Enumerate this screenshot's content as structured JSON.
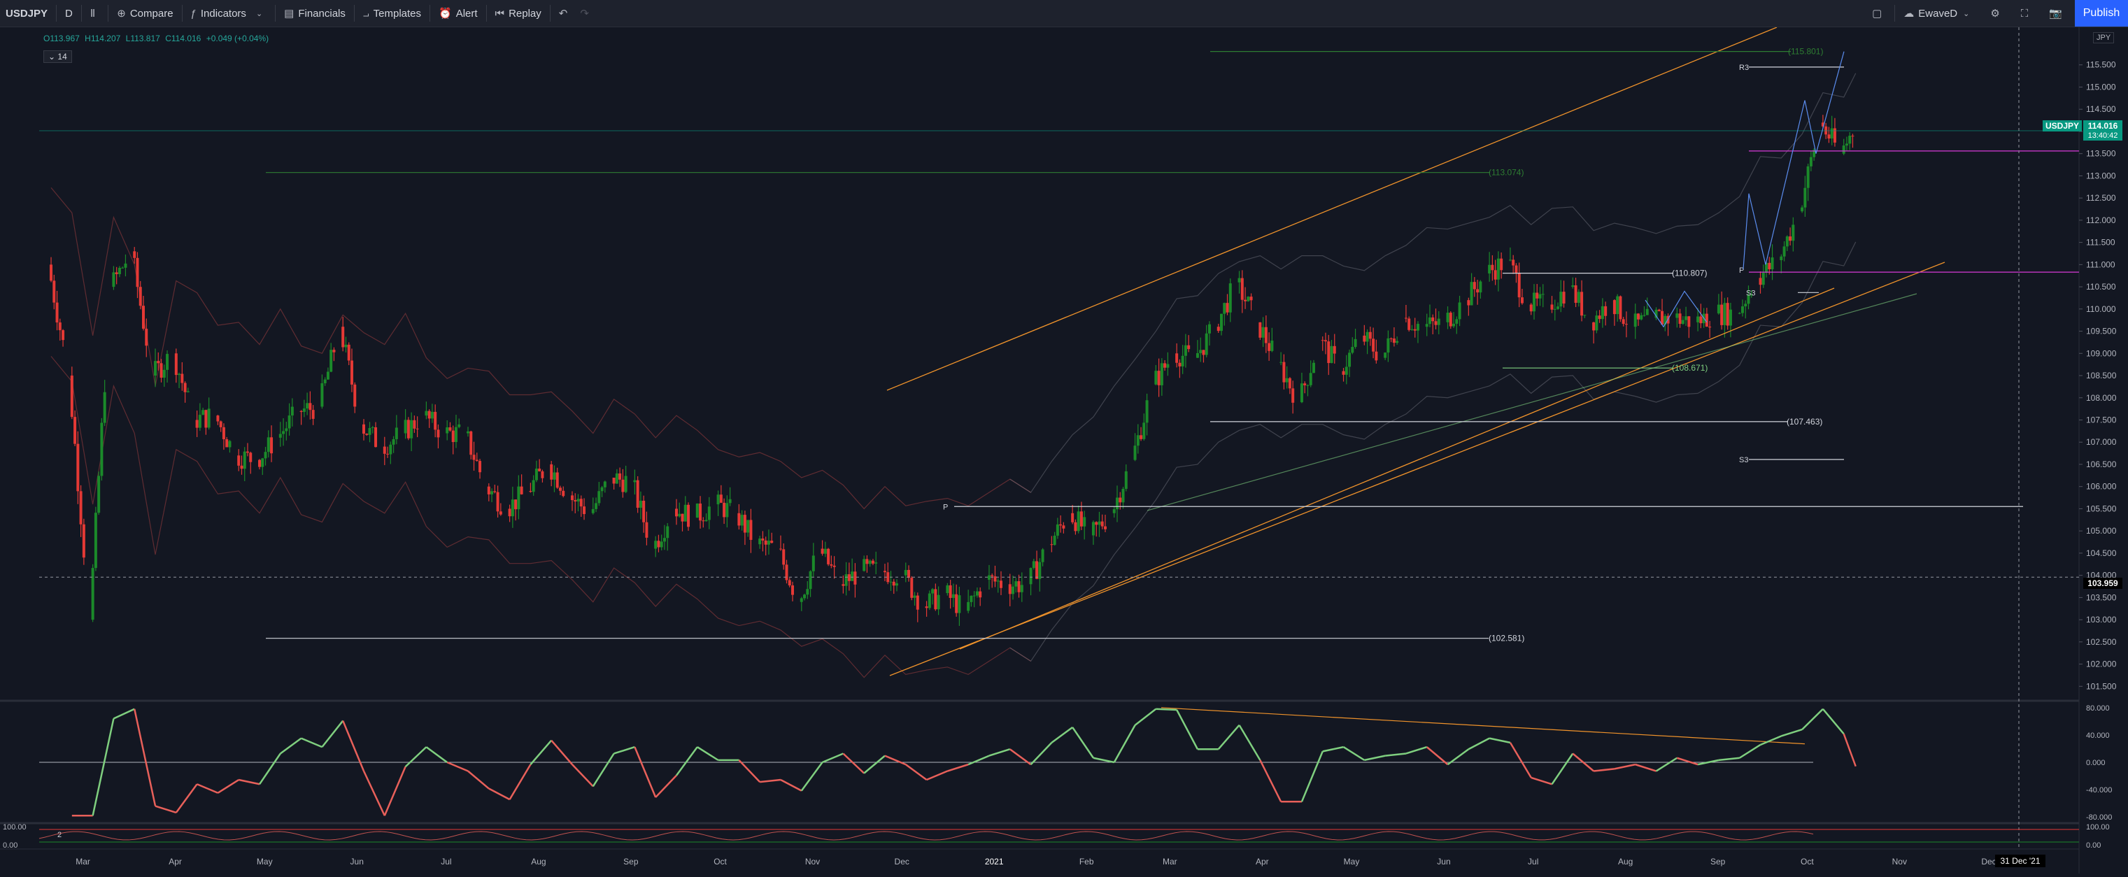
{
  "toolbar": {
    "symbol": "USDJPY",
    "interval": "D",
    "compare": "Compare",
    "indicators": "Indicators",
    "financials": "Financials",
    "templates": "Templates",
    "alert": "Alert",
    "replay": "Replay",
    "user": "EwaveD",
    "publish": "Publish",
    "icons": [
      "bar-style-icon",
      "plus-circle-icon",
      "fx-icon",
      "chevron-down-icon",
      "financials-icon",
      "templates-icon",
      "alarm-icon",
      "replay-icon",
      "undo-icon",
      "redo-icon",
      "square-icon",
      "cloud-icon",
      "settings-gear-icon",
      "fullscreen-icon",
      "camera-icon"
    ]
  },
  "legend": {
    "open": "O113.967",
    "high": "H114.207",
    "low": "L113.817",
    "close": "C114.016",
    "change": "+0.049 (+0.04%)",
    "ma_length": "14"
  },
  "price_scale": {
    "currency": "JPY",
    "current_symbol": "USDJPY",
    "current_price": "114.016",
    "countdown": "13:40:42",
    "crosshair_price": "103.959",
    "labels": [
      "115.500",
      "115.000",
      "114.500",
      "114.000",
      "113.500",
      "113.000",
      "112.500",
      "112.000",
      "111.500",
      "111.000",
      "110.500",
      "110.000",
      "109.500",
      "109.000",
      "108.500",
      "108.000",
      "107.500",
      "107.000",
      "106.500",
      "106.000",
      "105.500",
      "105.000",
      "104.500",
      "104.000",
      "103.500",
      "103.000",
      "102.500",
      "102.000",
      "101.500"
    ]
  },
  "time_axis": {
    "labels": [
      "Mar",
      "Apr",
      "May",
      "Jun",
      "Jul",
      "Aug",
      "Sep",
      "Oct",
      "Nov",
      "Dec",
      "2021",
      "Feb",
      "Mar",
      "Apr",
      "May",
      "Jun",
      "Jul",
      "Aug",
      "Sep",
      "Oct",
      "Nov",
      "Dec"
    ],
    "crosshair_date": "31 Dec '21"
  },
  "annotations": {
    "level_115801": "(115.801)",
    "level_113074": "(113.074)",
    "level_110807": "(110.807)",
    "level_108671": "(108.671)",
    "level_107463": "(107.463)",
    "level_102581": "(102.581)",
    "r3": "R3",
    "s3a": "S3",
    "s3b": "S3",
    "p1": "P",
    "p2": "P"
  },
  "osc_scale": [
    "80.000",
    "40.000",
    "0.000",
    "-40.000",
    "-80.000"
  ],
  "osc2": {
    "label": "2",
    "scale_top": "100.00",
    "scale_bottom": "0.00",
    "right_top": "100.00",
    "right_bottom": "0.00"
  },
  "colors": {
    "up": "#089981",
    "up_candle": "#1b8a2a",
    "down": "#e53935",
    "channel": "#f0932b",
    "magenta": "#d83ad8",
    "green_line": "#2e7d32",
    "osc_up": "#7fcf7f",
    "osc_down": "#e8605a"
  },
  "chart_data": {
    "type": "candlestick",
    "symbol": "USDJPY",
    "interval": "D",
    "ylim": [
      101.3,
      116.0
    ],
    "x_range": [
      "2020-02-20",
      "2022-01-05"
    ],
    "series": [
      {
        "name": "USDJPY",
        "points": [
          [
            "2020-02-24",
            111.0
          ],
          [
            "2020-03-02",
            108.5
          ],
          [
            "2020-03-09",
            103.0
          ],
          [
            "2020-03-16",
            110.5
          ],
          [
            "2020-03-23",
            111.3
          ],
          [
            "2020-03-30",
            108.5
          ],
          [
            "2020-04-06",
            109.0
          ],
          [
            "2020-04-13",
            107.5
          ],
          [
            "2020-04-20",
            107.6
          ],
          [
            "2020-04-27",
            106.7
          ],
          [
            "2020-05-04",
            106.6
          ],
          [
            "2020-05-11",
            107.1
          ],
          [
            "2020-05-18",
            107.7
          ],
          [
            "2020-05-25",
            107.8
          ],
          [
            "2020-06-01",
            109.6
          ],
          [
            "2020-06-08",
            107.4
          ],
          [
            "2020-06-15",
            106.9
          ],
          [
            "2020-06-22",
            107.2
          ],
          [
            "2020-06-29",
            107.6
          ],
          [
            "2020-07-06",
            107.2
          ],
          [
            "2020-07-13",
            107.2
          ],
          [
            "2020-07-20",
            106.0
          ],
          [
            "2020-07-27",
            105.5
          ],
          [
            "2020-08-03",
            105.9
          ],
          [
            "2020-08-10",
            106.5
          ],
          [
            "2020-08-17",
            105.8
          ],
          [
            "2020-08-24",
            105.4
          ],
          [
            "2020-08-31",
            106.2
          ],
          [
            "2020-09-07",
            106.1
          ],
          [
            "2020-09-14",
            104.6
          ],
          [
            "2020-09-21",
            105.5
          ],
          [
            "2020-09-28",
            105.3
          ],
          [
            "2020-10-05",
            105.6
          ],
          [
            "2020-10-12",
            105.4
          ],
          [
            "2020-10-19",
            104.7
          ],
          [
            "2020-10-26",
            104.6
          ],
          [
            "2020-11-02",
            103.4
          ],
          [
            "2020-11-09",
            104.6
          ],
          [
            "2020-11-16",
            103.8
          ],
          [
            "2020-11-23",
            104.1
          ],
          [
            "2020-11-30",
            104.1
          ],
          [
            "2020-12-07",
            104.0
          ],
          [
            "2020-12-14",
            103.3
          ],
          [
            "2020-12-21",
            103.6
          ],
          [
            "2020-12-28",
            103.2
          ],
          [
            "2021-01-04",
            103.9
          ],
          [
            "2021-01-11",
            103.8
          ],
          [
            "2021-01-18",
            103.8
          ],
          [
            "2021-01-25",
            104.7
          ],
          [
            "2021-02-01",
            105.4
          ],
          [
            "2021-02-08",
            104.9
          ],
          [
            "2021-02-15",
            105.4
          ],
          [
            "2021-02-22",
            106.6
          ],
          [
            "2021-03-01",
            108.3
          ],
          [
            "2021-03-08",
            109.0
          ],
          [
            "2021-03-15",
            108.9
          ],
          [
            "2021-03-22",
            109.6
          ],
          [
            "2021-03-29",
            110.6
          ],
          [
            "2021-04-05",
            109.7
          ],
          [
            "2021-04-12",
            108.8
          ],
          [
            "2021-04-19",
            107.9
          ],
          [
            "2021-04-26",
            109.3
          ],
          [
            "2021-05-03",
            108.6
          ],
          [
            "2021-05-10",
            109.4
          ],
          [
            "2021-05-17",
            108.9
          ],
          [
            "2021-05-24",
            109.8
          ],
          [
            "2021-05-31",
            109.6
          ],
          [
            "2021-06-07",
            109.7
          ],
          [
            "2021-06-14",
            110.2
          ],
          [
            "2021-06-21",
            110.8
          ],
          [
            "2021-06-28",
            111.1
          ],
          [
            "2021-07-05",
            110.1
          ],
          [
            "2021-07-12",
            110.1
          ],
          [
            "2021-07-19",
            110.5
          ],
          [
            "2021-07-26",
            109.7
          ],
          [
            "2021-08-02",
            110.2
          ],
          [
            "2021-08-09",
            109.6
          ],
          [
            "2021-08-16",
            109.8
          ],
          [
            "2021-08-23",
            109.8
          ],
          [
            "2021-08-30",
            109.7
          ],
          [
            "2021-09-06",
            109.9
          ],
          [
            "2021-09-13",
            109.9
          ],
          [
            "2021-09-20",
            110.7
          ],
          [
            "2021-09-27",
            111.1
          ],
          [
            "2021-10-04",
            112.2
          ],
          [
            "2021-10-11",
            114.2
          ],
          [
            "2021-10-18",
            113.5
          ],
          [
            "2021-10-22",
            114.016
          ]
        ]
      }
    ],
    "horizontal_levels": [
      115.801,
      113.074,
      110.807,
      108.671,
      107.463,
      102.581
    ],
    "oscillator": {
      "ylim": [
        -88,
        88
      ],
      "levels": [
        80,
        40,
        0,
        -40,
        -80
      ]
    }
  }
}
